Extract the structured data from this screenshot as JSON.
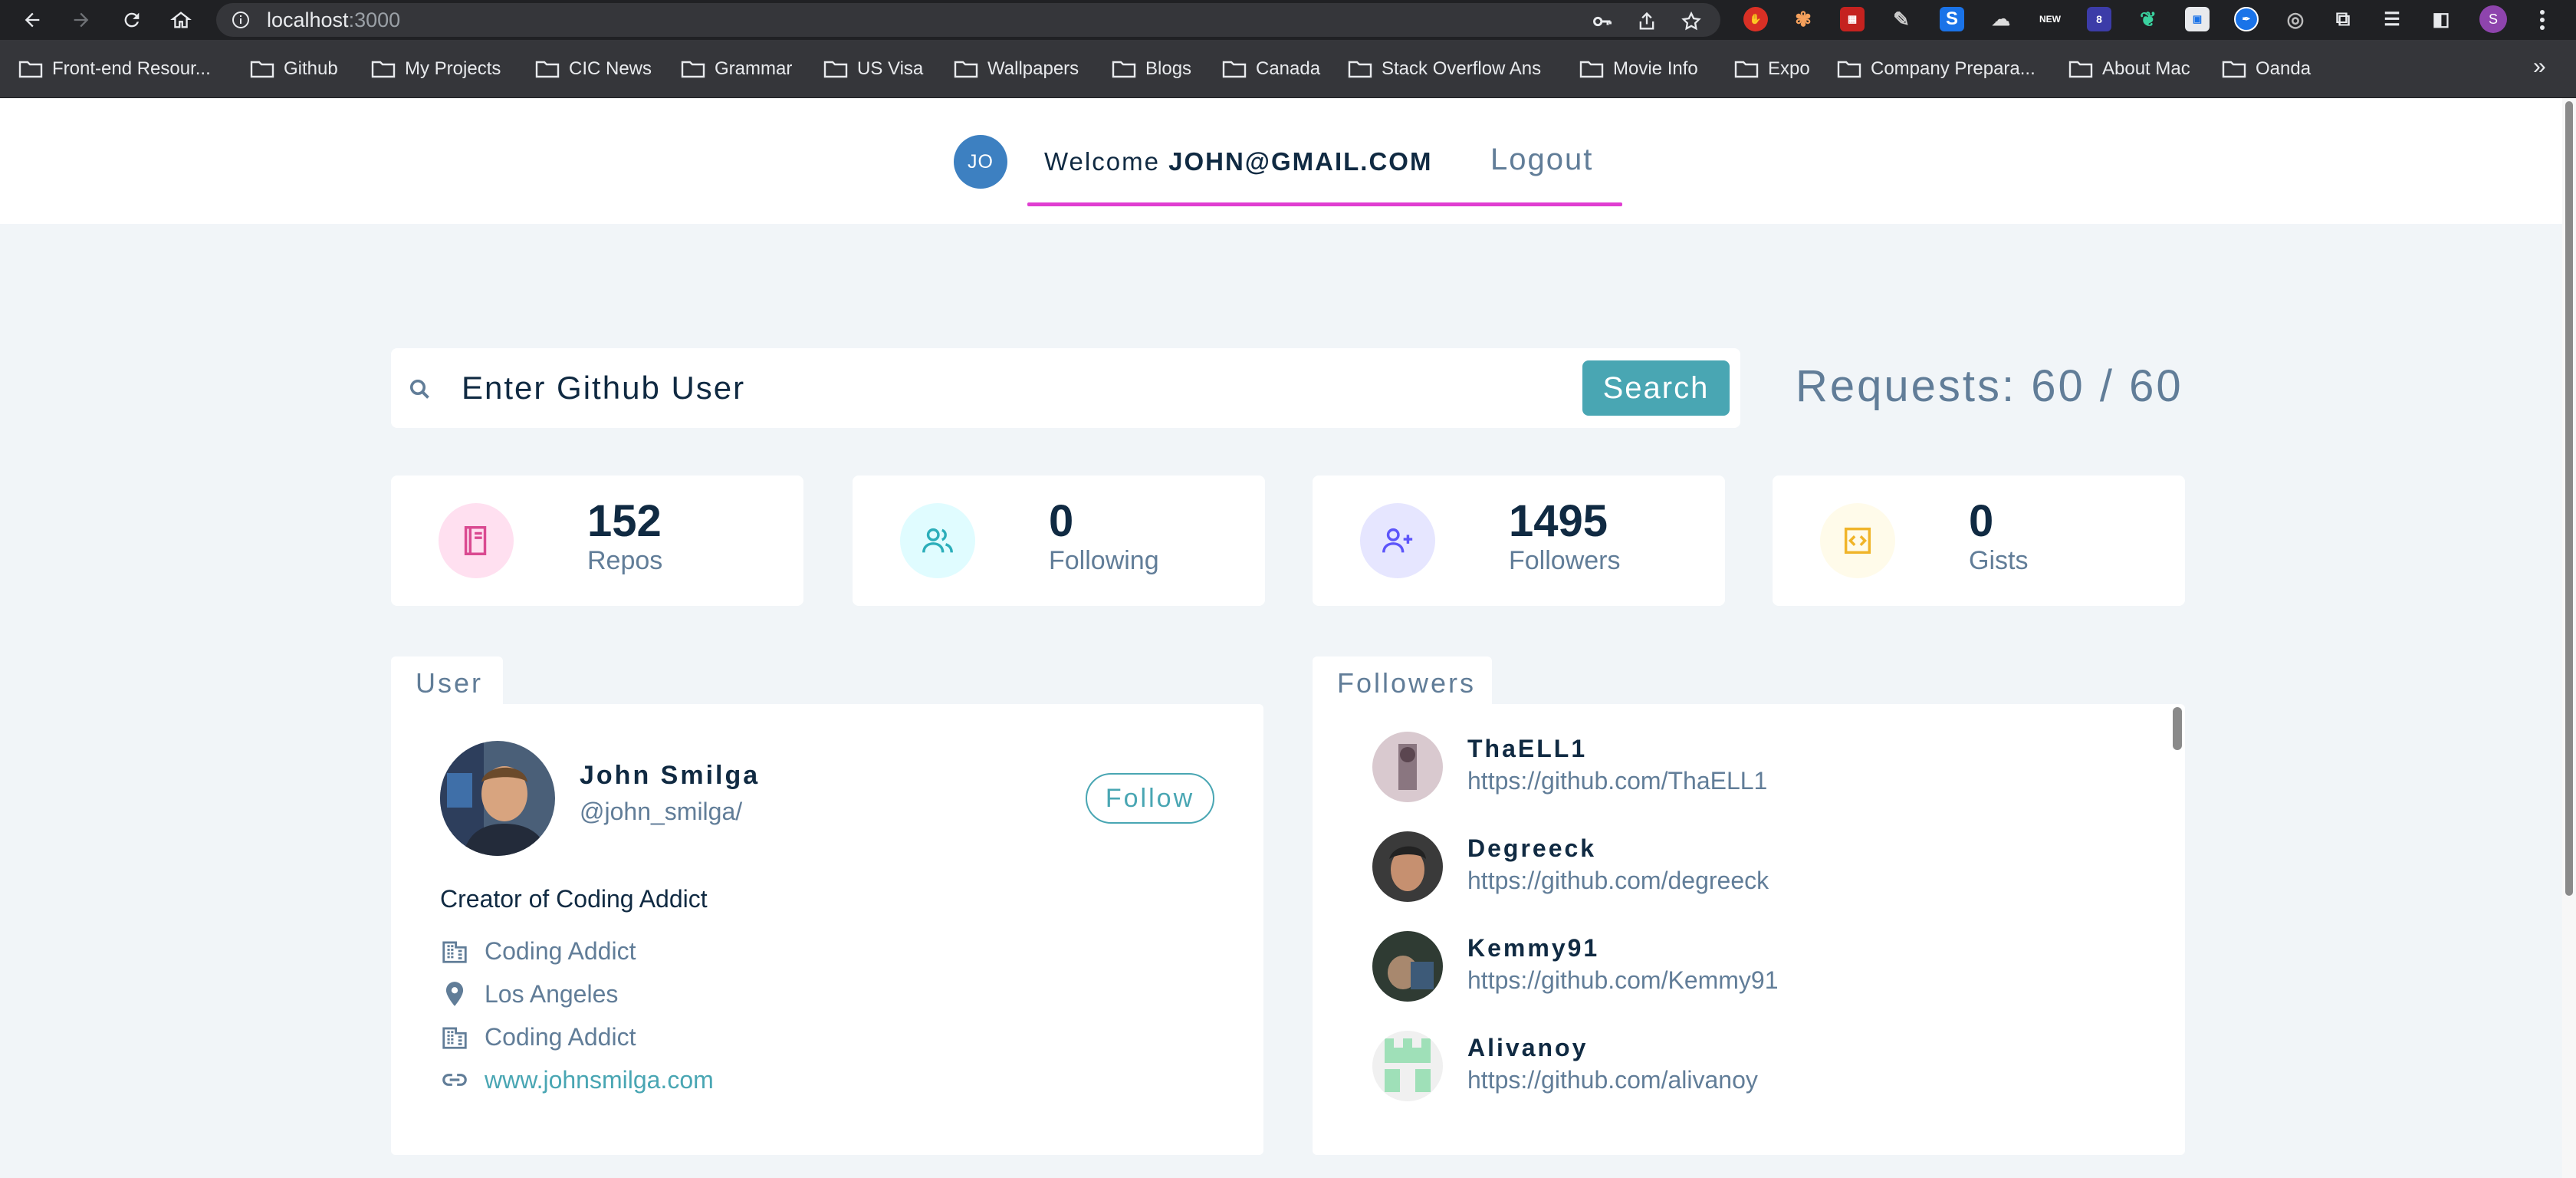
{
  "browser": {
    "url_host": "localhost",
    "url_port": ":3000",
    "bookmarks": [
      "Front-end Resour...",
      "Github",
      "My Projects",
      "CIC News",
      "Grammar",
      "US Visa",
      "Wallpapers",
      "Blogs",
      "Canada",
      "Stack Overflow Ans",
      "Movie Info",
      "Expo",
      "Company Prepara...",
      "About Mac",
      "Oanda"
    ],
    "more_bookmarks": "»",
    "profile_initial": "S",
    "ext_badge_new": "NEW",
    "ext_badge_count": "8"
  },
  "nav": {
    "avatar_initials": "JO",
    "welcome_prefix": "Welcome",
    "welcome_user": "JOHN@GMAIL.COM",
    "logout_label": "Logout",
    "accent_color": "#e03ed1"
  },
  "search": {
    "placeholder": "Enter Github User",
    "button_label": "Search",
    "requests_text": "Requests: 60 / 60"
  },
  "stats": [
    {
      "value": "152",
      "label": "Repos",
      "icon": "book-icon",
      "color": "#da4a91",
      "bg": "#ffe0f0"
    },
    {
      "value": "0",
      "label": "Following",
      "icon": "users-icon",
      "color": "#2caeba",
      "bg": "#e0fcff"
    },
    {
      "value": "1495",
      "label": "Followers",
      "icon": "user-plus-icon",
      "color": "#5d55fa",
      "bg": "#e6e6ff"
    },
    {
      "value": "0",
      "label": "Gists",
      "icon": "code-icon",
      "color": "#f0b429",
      "bg": "#fffbea"
    }
  ],
  "user": {
    "tab_label": "User",
    "name": "John Smilga",
    "handle": "@john_smilga/",
    "follow_label": "Follow",
    "bio": "Creator of Coding Addict",
    "company": "Coding Addict",
    "location": "Los Angeles",
    "company2": "Coding Addict",
    "blog": "www.johnsmilga.com"
  },
  "followers": {
    "tab_label": "Followers",
    "items": [
      {
        "login": "ThaELL1",
        "url": "https://github.com/ThaELL1"
      },
      {
        "login": "Degreeck",
        "url": "https://github.com/degreeck"
      },
      {
        "login": "Kemmy91",
        "url": "https://github.com/Kemmy91"
      },
      {
        "login": "Alivanoy",
        "url": "https://github.com/alivanoy"
      }
    ]
  }
}
